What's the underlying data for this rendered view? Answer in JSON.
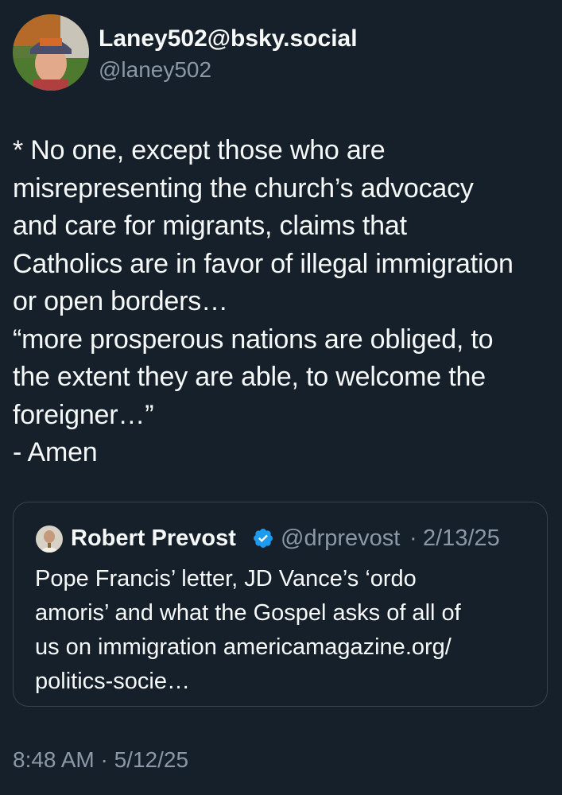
{
  "author": {
    "display_name": "Laney502@bsky.social",
    "handle": "@laney502"
  },
  "post": {
    "lines": [
      "* No one, except those who are",
      "misrepresenting the church’s advocacy",
      "and care for migrants, claims that",
      "Catholics are in favor of illegal immigration",
      "or open borders…",
      "“more prosperous nations are obliged, to",
      "the extent they are able, to welcome the",
      "foreigner…”",
      "- Amen"
    ]
  },
  "quoted": {
    "display_name": "Robert Prevost",
    "handle": "@drprevost",
    "separator": "·",
    "date": "2/13/25",
    "verified_icon": "verified-badge-icon",
    "lines": [
      "Pope Francis’ letter, JD Vance’s ‘ordo",
      "amoris’ and what the Gospel asks of all of",
      "us on immigration americamagazine.org/",
      "politics-socie…"
    ]
  },
  "timestamp": "8:48 AM · 5/12/25",
  "colors": {
    "background": "#15202b",
    "primary_text": "#f7f9f9",
    "secondary_text": "#8b98a5",
    "border": "#38444d",
    "verified": "#1d9bf0"
  }
}
